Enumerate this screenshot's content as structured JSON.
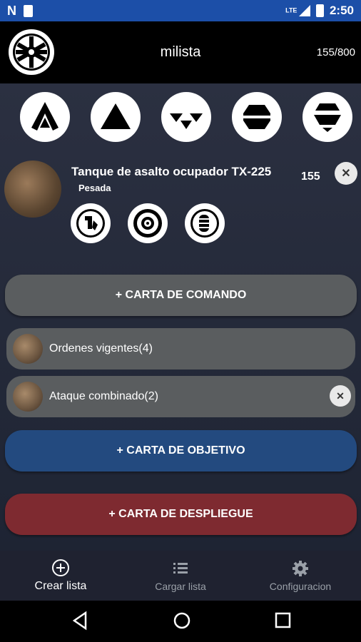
{
  "status": {
    "time": "2:50",
    "lte": "LTE"
  },
  "app": {
    "title": "milista",
    "points": "155/800"
  },
  "unit": {
    "name": "Tanque de asalto ocupador TX-225",
    "type": "Pesada",
    "cost": "155",
    "remove": "✕"
  },
  "command": {
    "add_label": "+ CARTA DE COMANDO"
  },
  "cards": [
    {
      "label": "Ordenes vigentes(4)"
    },
    {
      "label": "Ataque combinado(2)",
      "remove": "✕"
    }
  ],
  "objective": {
    "add_label": "+ CARTA DE OBJETIVO"
  },
  "deployment": {
    "add_label": "+ CARTA DE DESPLIEGUE"
  },
  "nav": {
    "create": "Crear lista",
    "load": "Cargar lista",
    "settings": "Configuracion"
  },
  "colors": {
    "statusbar": "#1c4fa8",
    "objective": "#234a7f",
    "deployment": "#7e2a30",
    "command": "#5a5d5f"
  }
}
